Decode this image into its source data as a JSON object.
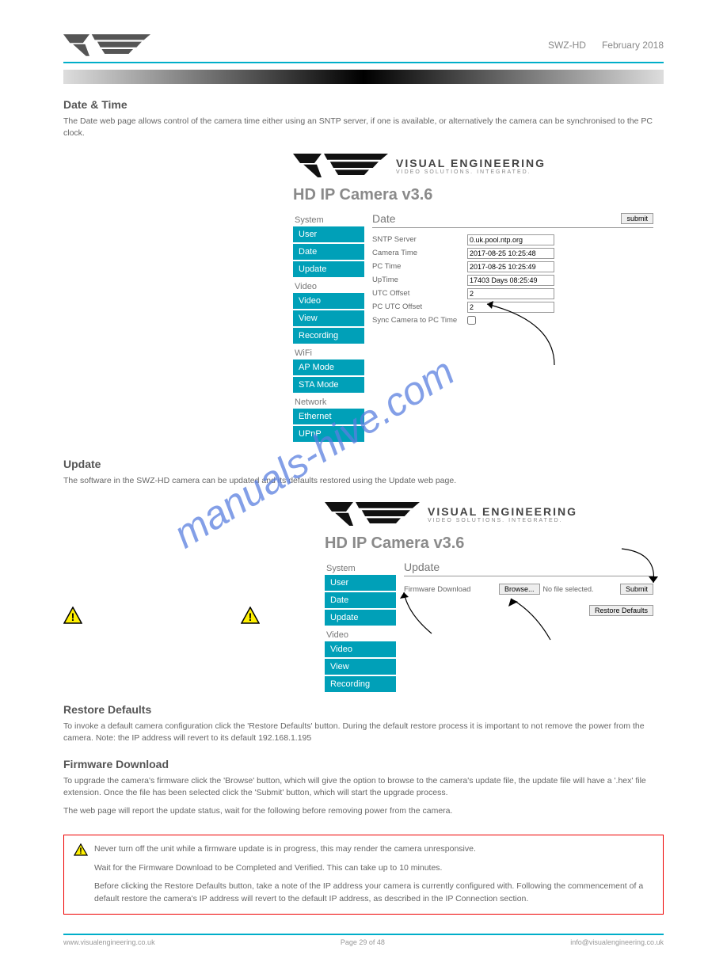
{
  "header": {
    "model": "SWZ-HD",
    "date": "February 2018"
  },
  "brand": {
    "line1": "VISUAL ENGINEERING",
    "line2": "VIDEO SOLUTIONS. INTEGRATED."
  },
  "camera_title": "HD IP Camera v3.6",
  "sidebar": {
    "system_label": "System",
    "user": "User",
    "date": "Date",
    "update": "Update",
    "video_label": "Video",
    "video": "Video",
    "view": "View",
    "recording": "Recording",
    "wifi_label": "WiFi",
    "ap_mode": "AP Mode",
    "sta_mode": "STA Mode",
    "network_label": "Network",
    "ethernet": "Ethernet",
    "upnp": "UPnP"
  },
  "date_section": {
    "heading": "Date & Time",
    "para": "The Date web page allows control of the camera time either using an SNTP server, if one is available, or alternatively the camera can be synchronised to the PC clock.",
    "title": "Date",
    "submit": "submit",
    "rows": {
      "sntp_label": "SNTP Server",
      "sntp_val": "0.uk.pool.ntp.org",
      "cam_time_label": "Camera Time",
      "cam_time_val": "2017-08-25 10:25:48",
      "pc_time_label": "PC Time",
      "pc_time_val": "2017-08-25 10:25:49",
      "uptime_label": "UpTime",
      "uptime_val": "17403 Days 08:25:49",
      "utc_label": "UTC Offset",
      "utc_val": "2",
      "pcutc_label": "PC UTC Offset",
      "pcutc_val": "2",
      "sync_label": "Sync Camera to PC Time"
    }
  },
  "update_section": {
    "heading": "Update",
    "para": "The software in the SWZ-HD camera can be updated and its defaults restored using the Update web page.",
    "title": "Update",
    "firmware_label": "Firmware Download",
    "browse": "Browse...",
    "no_file": "No file selected.",
    "submit": "Submit",
    "restore": "Restore Defaults"
  },
  "defaults_section": {
    "heading": "Restore Defaults",
    "para": "To invoke a default camera configuration click the 'Restore Defaults' button. During the default restore process it is important to not remove the power from the camera. Note: the IP address will revert to its default 192.168.1.195"
  },
  "firmware_section": {
    "heading": "Firmware Download",
    "para1": "To upgrade the camera's firmware click the 'Browse' button, which will give the option to browse to the camera's update file, the update file will have a '.hex' file extension. Once the file has been selected click the 'Submit' button, which will start the upgrade process.",
    "para2": "The web page will report the update status, wait for the following before removing power from the camera."
  },
  "warn": {
    "line1": "Never turn off the unit while a firmware update is in progress, this may render the camera unresponsive.",
    "line2": "Wait for the Firmware Download to be Completed and Verified. This can take up to 10 minutes.",
    "line3": "Before clicking the Restore Defaults button, take a note of the IP address your camera is currently configured with. Following the commencement of a default restore the camera's IP address will revert to the default IP address, as described in the IP Connection section."
  },
  "footer": {
    "left": "www.visualengineering.co.uk",
    "page": "Page 29 of 48",
    "right": "info@visualengineering.co.uk"
  }
}
